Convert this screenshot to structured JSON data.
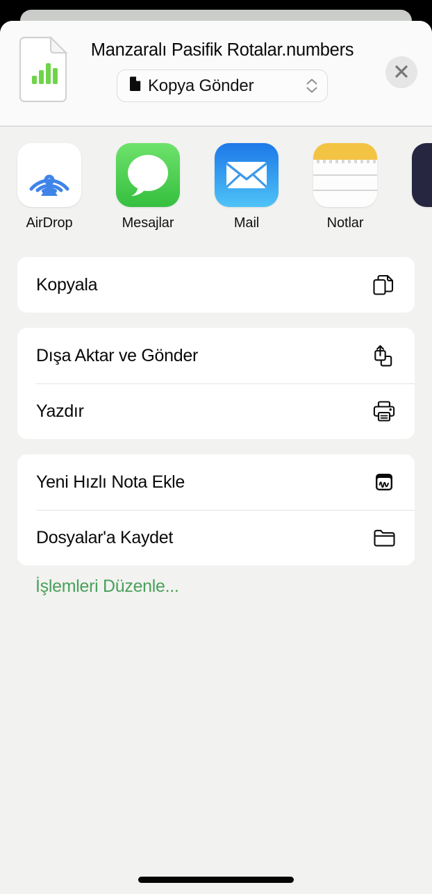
{
  "sheet": {
    "document_title": "Manzaralı Pasifik Rotalar.numbers",
    "document_icon": "numbers-spreadsheet-icon",
    "close_label": "close-icon",
    "options": {
      "label": "Kopya Gönder",
      "leading_icon": "document-icon",
      "trailing_icon": "chevron-up-down-icon"
    }
  },
  "apps": [
    {
      "label": "AirDrop",
      "icon": "airdrop-icon"
    },
    {
      "label": "Mesajlar",
      "icon": "messages-icon"
    },
    {
      "label": "Mail",
      "icon": "mail-icon"
    },
    {
      "label": "Notlar",
      "icon": "notes-icon"
    },
    {
      "label": "",
      "icon": "partial-app-icon"
    }
  ],
  "action_groups": [
    {
      "rows": [
        {
          "label": "Kopyala",
          "icon": "copy-icon"
        }
      ]
    },
    {
      "rows": [
        {
          "label": "Dışa Aktar ve Gönder",
          "icon": "share-export-icon"
        },
        {
          "label": "Yazdır",
          "icon": "printer-icon"
        }
      ]
    },
    {
      "rows": [
        {
          "label": "Yeni Hızlı Nota Ekle",
          "icon": "quick-note-icon"
        },
        {
          "label": "Dosyalar'a Kaydet",
          "icon": "folder-icon"
        }
      ]
    }
  ],
  "edit_actions": {
    "label": "İşlemleri Düzenle...",
    "color": "#4aa05c"
  },
  "home_indicator": "home-indicator"
}
